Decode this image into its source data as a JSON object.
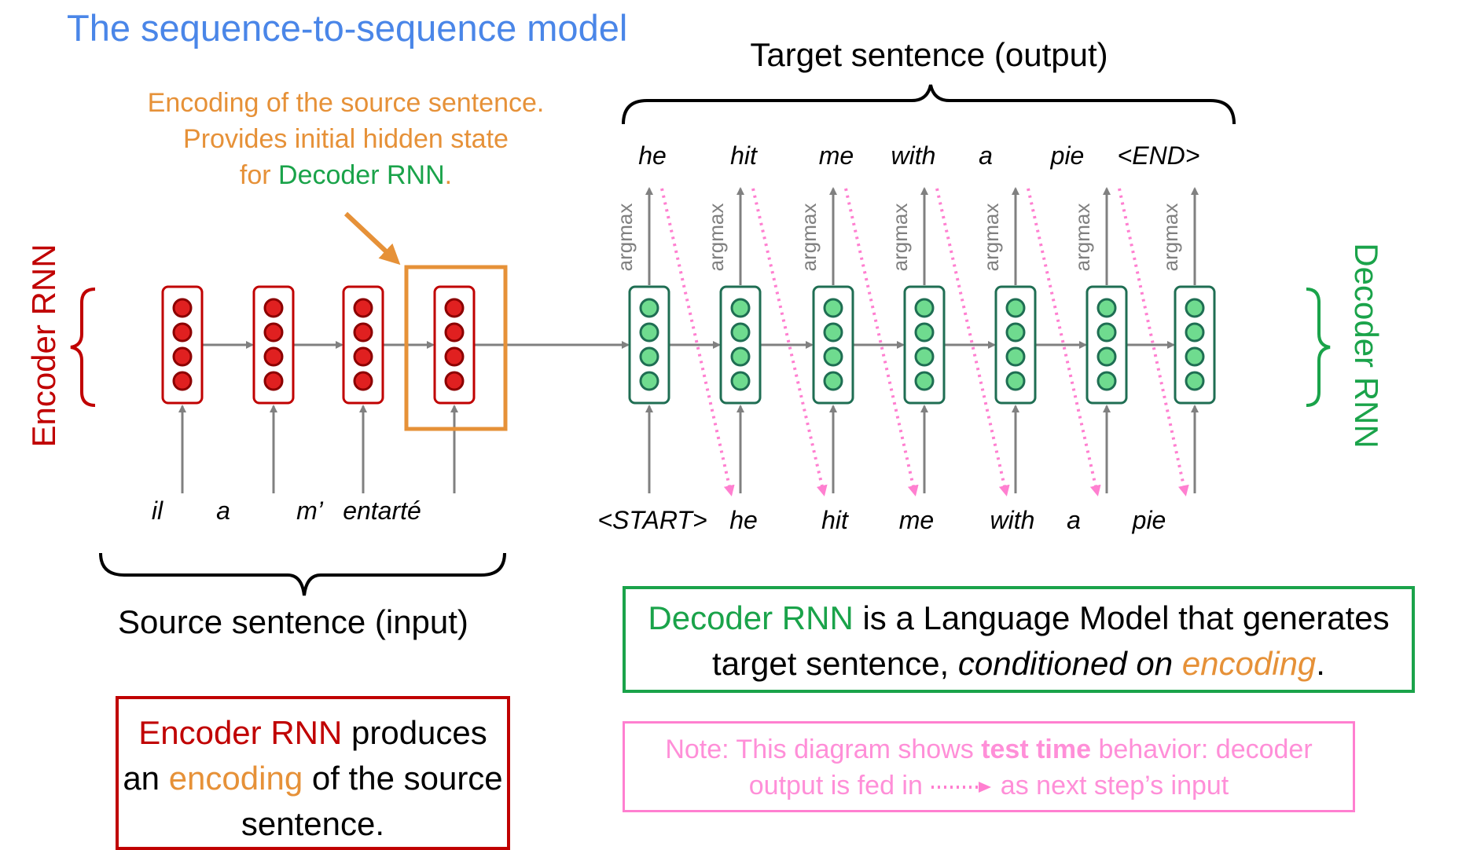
{
  "title": "The sequence-to-sequence model",
  "target_label": "Target sentence (output)",
  "source_label": "Source sentence (input)",
  "encoding_note": {
    "line1": "Encoding of the source sentence.",
    "line2": "Provides initial hidden state",
    "line3_prefix": "for ",
    "line3_green": "Decoder RNN",
    "line3_suffix": "."
  },
  "encoder_side_label": "Encoder RNN",
  "decoder_side_label": "Decoder RNN",
  "argmax_label": "argmax",
  "source_words": [
    "il",
    "a",
    "m’",
    "entarté"
  ],
  "decoder_input_words": [
    "<START>",
    "he",
    "hit",
    "me",
    "with",
    "a",
    "pie"
  ],
  "decoder_output_words": [
    "he",
    "hit",
    "me",
    "with",
    "a",
    "pie",
    "<END>"
  ],
  "encoder_box": {
    "part1": "Encoder RNN",
    "part2": " produces an ",
    "part3": "encoding",
    "part4": " of the source sentence."
  },
  "decoder_box": {
    "part1": "Decoder RNN",
    "part2": " is a Language Model that generates target sentence, ",
    "part3": "conditioned on",
    "part4": " ",
    "part5": "encoding",
    "part6": "."
  },
  "note_box": {
    "part1": "Note: This diagram shows ",
    "part2": "test time",
    "part3": " behavior: decoder output is fed in ",
    "part4": " as next step’s input"
  },
  "colors": {
    "title": "#4a86e8",
    "encoder": "#c00000",
    "decoder": "#1aa34a",
    "encoding": "#e69138",
    "note": "#ff7fd0",
    "arrow": "#808080"
  }
}
